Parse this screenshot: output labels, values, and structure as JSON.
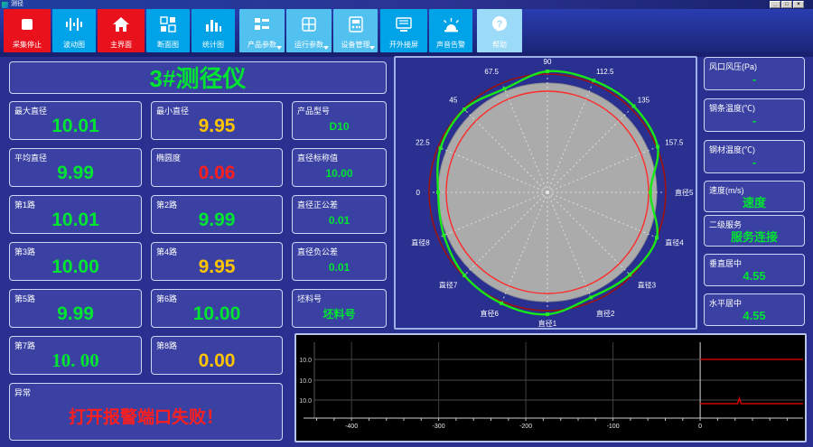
{
  "window": {
    "title": "测径",
    "controls": {
      "minimize": "_",
      "maximize": "□",
      "close": "×"
    }
  },
  "toolbar": {
    "buttons": [
      {
        "label": "采集停止",
        "style": "red"
      },
      {
        "label": "波动图",
        "style": "blue"
      },
      {
        "label": "主界面",
        "style": "red"
      },
      {
        "label": "断面图",
        "style": "blue"
      },
      {
        "label": "统计图",
        "style": "blue"
      },
      {
        "label": "产品参数",
        "style": "light",
        "dropdown": true
      },
      {
        "label": "运行参数",
        "style": "light",
        "dropdown": true
      },
      {
        "label": "设备管理",
        "style": "light",
        "dropdown": true
      },
      {
        "label": "开外接屏",
        "style": "blue"
      },
      {
        "label": "声音告警",
        "style": "blue"
      },
      {
        "label": "帮助",
        "style": "lighter"
      }
    ]
  },
  "left_panel": {
    "title": "3#测径仪",
    "cells": [
      {
        "label": "最大直径",
        "value": "10.01",
        "color": "#00E432"
      },
      {
        "label": "最小直径",
        "value": "9.95",
        "color": "#FFC400"
      },
      {
        "label": "产品型号",
        "value": "D10",
        "color": "#00E432"
      },
      {
        "label": "平均直径",
        "value": "9.99",
        "color": "#00E432"
      },
      {
        "label": "椭圆度",
        "value": "0.06",
        "color": "#FF1E1E"
      },
      {
        "label": "直径标称值",
        "value": "10.00",
        "color": "#00E432"
      },
      {
        "label": "第1路",
        "value": "10.01",
        "color": "#00E432"
      },
      {
        "label": "第2路",
        "value": "9.99",
        "color": "#00E432"
      },
      {
        "label": "直径正公差",
        "value": "0.01",
        "color": "#00E432"
      },
      {
        "label": "第3路",
        "value": "10.00",
        "color": "#00E432"
      },
      {
        "label": "第4路",
        "value": "9.95",
        "color": "#FFC400"
      },
      {
        "label": "直径负公差",
        "value": "0.01",
        "color": "#00E432"
      },
      {
        "label": "第5路",
        "value": "9.99",
        "color": "#00E432"
      },
      {
        "label": "第6路",
        "value": "10.00",
        "color": "#00E432"
      },
      {
        "label": "坯料号",
        "value": "坯料号",
        "color": "#00E432"
      },
      {
        "label": "第7路",
        "value": "10. 00",
        "color": "#00E432"
      },
      {
        "label": "第8路",
        "value": "0.00",
        "color": "#FFC400"
      },
      {
        "label": "异常",
        "value": "打开报警端口失败！",
        "color": "#FF1E1E"
      }
    ]
  },
  "right_column": {
    "panels": [
      {
        "label": "风口风压(Pa)",
        "value": "-",
        "color": "#00E432"
      },
      {
        "label": "钢条温度(℃)",
        "value": "-",
        "color": "#00E432"
      },
      {
        "label": "钢材温度(℃)",
        "value": "-",
        "color": "#00E432"
      },
      {
        "label": "速度(m/s)",
        "value": "速度",
        "color": "#00E432"
      },
      {
        "label": "二级服务",
        "value": "服务连接",
        "color": "#00E432"
      },
      {
        "label": "垂直居中",
        "value": "4.55",
        "color": "#00E432"
      },
      {
        "label": "水平居中",
        "value": "4.55",
        "color": "#00E432"
      }
    ]
  },
  "polar_chart": {
    "spokes": [
      {
        "deg": 180,
        "label": "0"
      },
      {
        "deg": 157.5,
        "label": "22.5"
      },
      {
        "deg": 135,
        "label": "45"
      },
      {
        "deg": 112.5,
        "label": "67.5"
      },
      {
        "deg": 90,
        "label": "90"
      },
      {
        "deg": 67.5,
        "label": "112.5"
      },
      {
        "deg": 45,
        "label": "135"
      },
      {
        "deg": 22.5,
        "label": "157.5"
      },
      {
        "deg": 0,
        "label": "直径5"
      },
      {
        "deg": -22.5,
        "label": "直径4"
      },
      {
        "deg": -45,
        "label": "直径3"
      },
      {
        "deg": -67.5,
        "label": "直径2"
      },
      {
        "deg": -90,
        "label": "直径1"
      },
      {
        "deg": -112.5,
        "label": "直径6"
      },
      {
        "deg": -135,
        "label": "直径7"
      },
      {
        "deg": -157.5,
        "label": "直径8"
      }
    ],
    "profile_radii": [
      121,
      128,
      130,
      124,
      134,
      134,
      135,
      132,
      114,
      131,
      129,
      126,
      135,
      133,
      130,
      124
    ],
    "gray_radius": 121,
    "inner_circle_radius": 112,
    "outer_circle_radius": 131,
    "colors": {
      "profile": "#17E817",
      "inner": "#FF2A2A",
      "outer": "#9B1212",
      "disc": "#ABABAB",
      "spoke": "#E6E6E6"
    }
  },
  "bottom_chart": {
    "chart_data": {
      "type": "line",
      "title": "",
      "x_tick_labels": [
        "-400",
        "-300",
        "-200",
        "-100",
        "0"
      ],
      "x_tick_values": [
        -400,
        -300,
        -200,
        -100,
        0
      ],
      "x_range": [
        -455,
        118
      ],
      "y_grid_labels": [
        "10.0",
        "10.0",
        "10.0"
      ],
      "grid": true,
      "series": [
        {
          "name": "trace-upper",
          "color": "#CC0000",
          "x_from": 0,
          "x_to": 118,
          "grid_index": 0,
          "offset": 0,
          "spike_x": null
        },
        {
          "name": "trace-lower",
          "color": "#CC0000",
          "x_from": 0,
          "x_to": 118,
          "grid_index": 2,
          "offset": 4,
          "spike_x": 45
        }
      ]
    }
  },
  "status_colors": {
    "ok": "#00E432",
    "warn": "#FFC400",
    "alarm": "#FF1E1E"
  }
}
